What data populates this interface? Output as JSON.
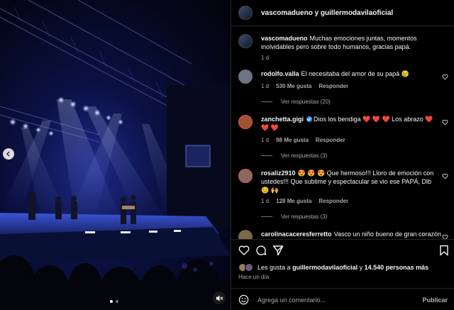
{
  "header": {
    "title": "vascomadueno y guillermodavilaoficial"
  },
  "caption": {
    "user": "vascomadueno",
    "text": "Muchas emociones juntas, momentos inolvidables pero sobre todo humanos, gracias papá.",
    "time": "1 d"
  },
  "comments": [
    {
      "user": "rodolfo.valla",
      "text": "El necesitaba del amor de su papá 😢",
      "time": "1 d",
      "likes": "530 Me gusta",
      "reply": "Responder",
      "view_replies": "Ver respuestas (20)",
      "avatar_color": "#6b7480"
    },
    {
      "user": "zanchetta.gigi",
      "text": "Dios los bendiga ❤️ ❤️ ❤️ Los abrazo ❤️ ❤️ ❤️",
      "time": "1 d",
      "likes": "98 Me gusta",
      "reply": "Responder",
      "view_replies": "Ver respuestas (3)",
      "avatar_color": "#a0522d"
    },
    {
      "user": "rosaliz2910",
      "text": "😍 😍 😍 Que hermoso!!! Lloro de emoción con ustedes!!! Que sublime y espectacular se vio ese PAPÁ, Dlb 😊 🙌",
      "time": "1 d",
      "likes": "128 Me gusta",
      "reply": "Responder",
      "view_replies": "Ver respuestas (3)",
      "avatar_color": "#8a6a5a"
    },
    {
      "user": "carolinacaceresferretto",
      "text": "Vasco un niño bueno de gran corazón",
      "time": "",
      "likes": "",
      "reply": "",
      "view_replies": "",
      "avatar_color": "#7a6a4a"
    }
  ],
  "likes": {
    "prefix": "Les gusta a",
    "user": "guillermodavilaoficial",
    "connector": "y",
    "others": "14.540 personas más"
  },
  "post_time": "Hace un día",
  "composer": {
    "placeholder": "Agrega un comentario...",
    "post_label": "Publicar"
  },
  "media": {
    "slides": 2,
    "active_slide": 1
  },
  "colors": {
    "background": "#000000",
    "text": "#f5f5f5",
    "muted": "#a8a8a8",
    "like_red": "#ff3040",
    "verified": "#3797f0"
  }
}
